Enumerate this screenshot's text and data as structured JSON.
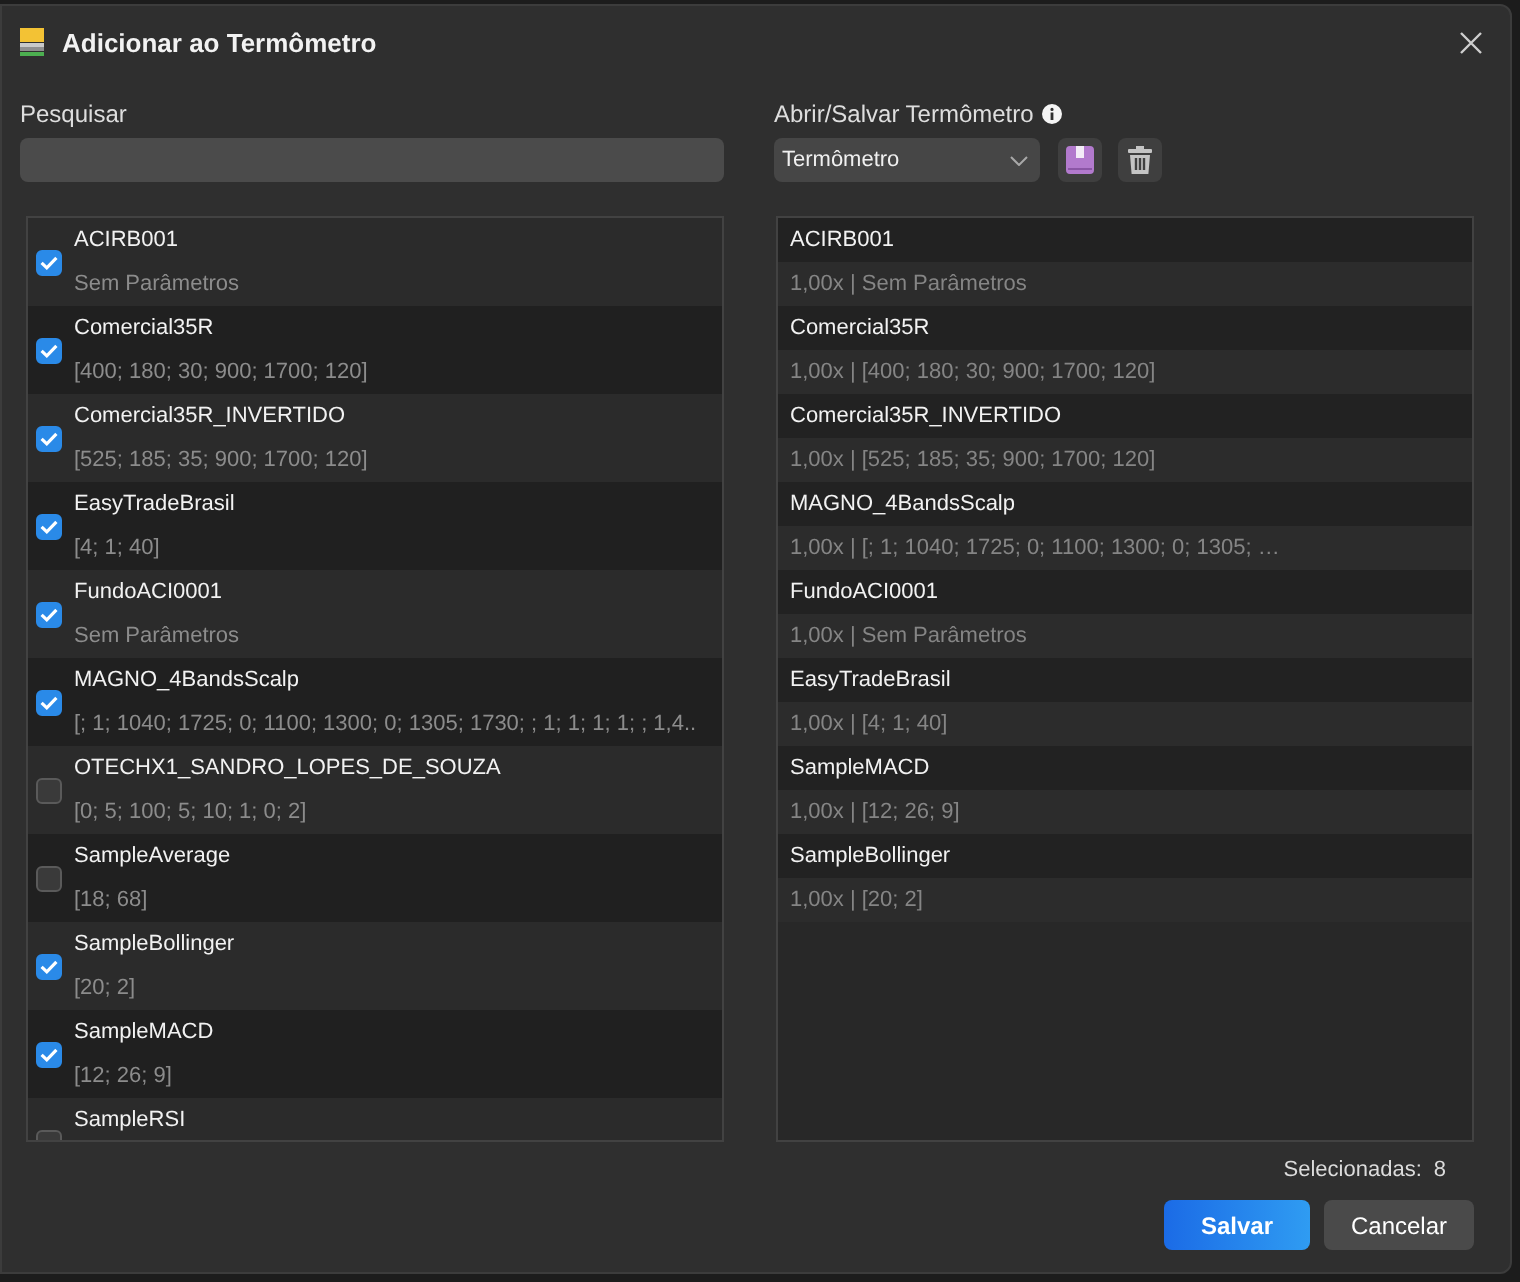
{
  "window": {
    "title": "Adicionar ao Termômetro"
  },
  "search": {
    "label": "Pesquisar"
  },
  "preset": {
    "label": "Abrir/Salvar Termômetro",
    "value": "Termômetro"
  },
  "indicators": [
    {
      "name": "ACIRB001",
      "params": "Sem Parâmetros",
      "checked": true
    },
    {
      "name": "Comercial35R",
      "params": "[400; 180; 30; 900; 1700; 120]",
      "checked": true
    },
    {
      "name": "Comercial35R_INVERTIDO",
      "params": "[525; 185; 35; 900; 1700; 120]",
      "checked": true
    },
    {
      "name": "EasyTradeBrasil",
      "params": "[4; 1; 40]",
      "checked": true
    },
    {
      "name": "FundoACI0001",
      "params": "Sem Parâmetros",
      "checked": true
    },
    {
      "name": "MAGNO_4BandsScalp",
      "params": "[; 1; 1040; 1725; 0; 1100; 1300; 0; 1305; 1730; ; 1; 1; 1; 1; ; 1,4..",
      "checked": true
    },
    {
      "name": "OTECHX1_SANDRO_LOPES_DE_SOUZA",
      "params": "[0; 5; 100; 5; 10; 1; 0; 2]",
      "checked": false
    },
    {
      "name": "SampleAverage",
      "params": "[18; 68]",
      "checked": false
    },
    {
      "name": "SampleBollinger",
      "params": "[20; 2]",
      "checked": true
    },
    {
      "name": "SampleMACD",
      "params": "[12; 26; 9]",
      "checked": true
    },
    {
      "name": "SampleRSI",
      "checked": false
    }
  ],
  "selected_list": [
    {
      "name": "ACIRB001",
      "detail": "1,00x | Sem Parâmetros"
    },
    {
      "name": "Comercial35R",
      "detail": "1,00x | [400; 180; 30; 900; 1700; 120]"
    },
    {
      "name": "Comercial35R_INVERTIDO",
      "detail": "1,00x | [525; 185; 35; 900; 1700; 120]"
    },
    {
      "name": "MAGNO_4BandsScalp",
      "detail": "1,00x | [; 1; 1040; 1725; 0; 1100; 1300; 0; 1305; …"
    },
    {
      "name": "FundoACI0001",
      "detail": "1,00x | Sem Parâmetros"
    },
    {
      "name": "EasyTradeBrasil",
      "detail": "1,00x | [4; 1; 40]"
    },
    {
      "name": "SampleMACD",
      "detail": "1,00x | [12; 26; 9]"
    },
    {
      "name": "SampleBollinger",
      "detail": "1,00x | [20; 2]"
    }
  ],
  "footer": {
    "count_label": "Selecionadas:",
    "count": "8"
  },
  "buttons": [
    {
      "label": "Salvar",
      "kind": "primary"
    },
    {
      "label": "Cancelar",
      "kind": "secondary"
    }
  ]
}
